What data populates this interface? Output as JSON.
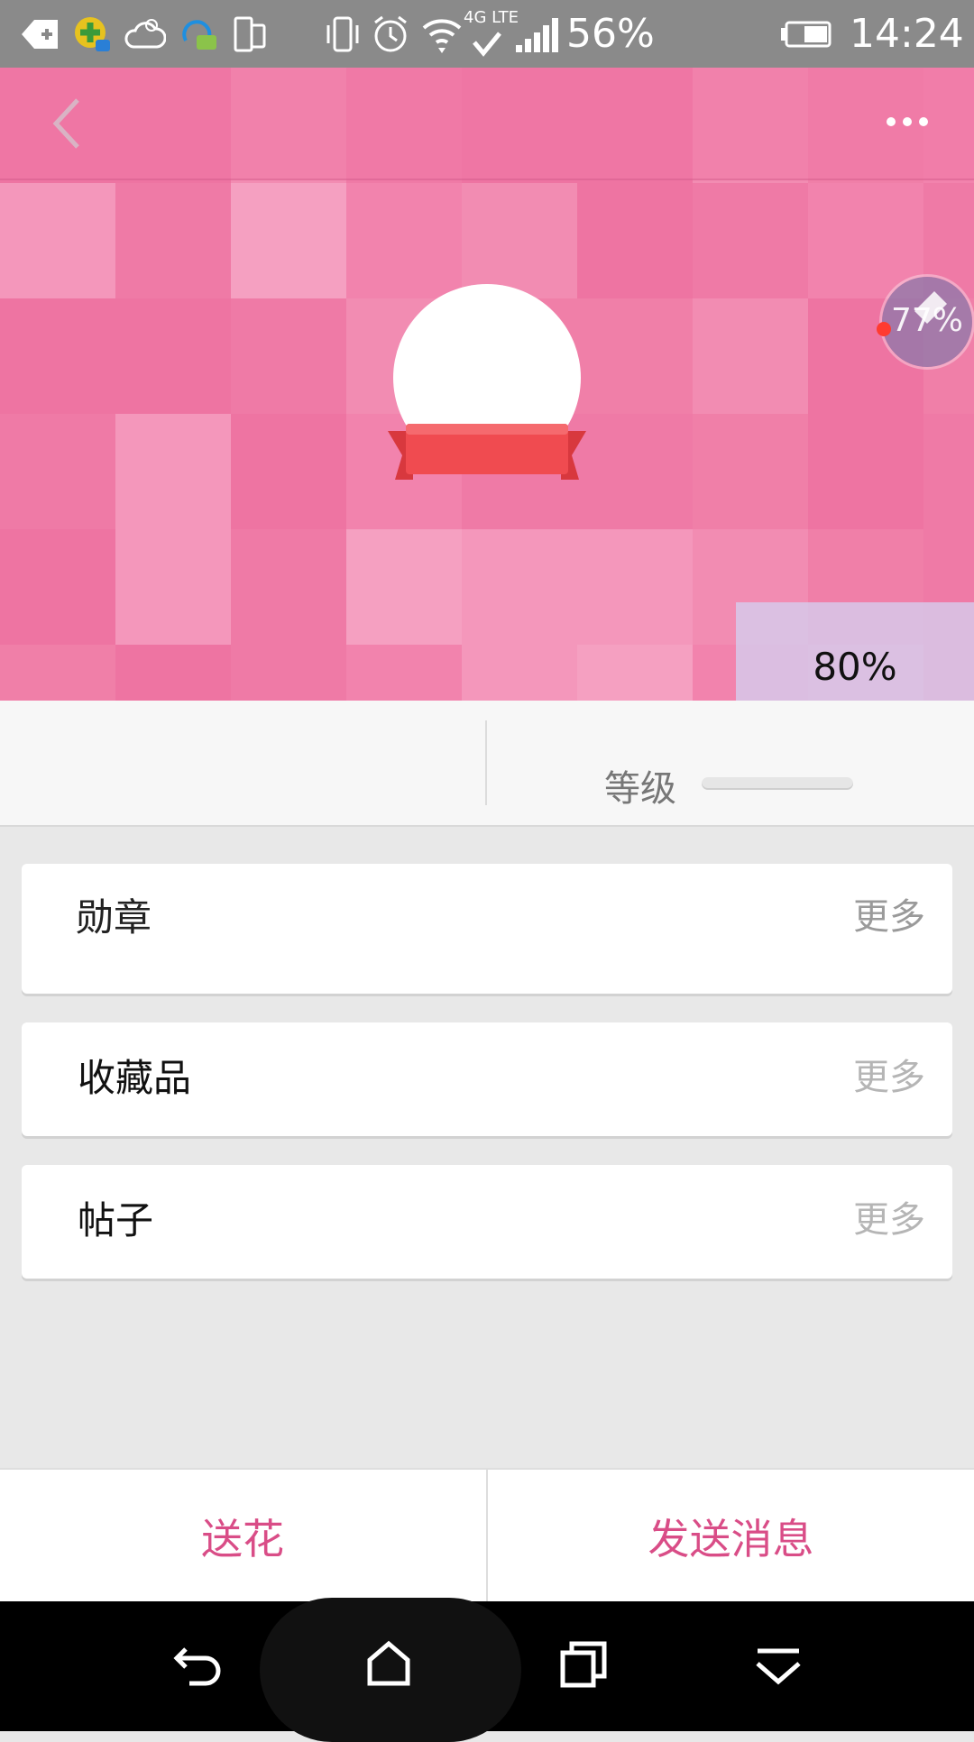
{
  "status_bar": {
    "battery_percent": "56%",
    "time": "14:24",
    "network": "4G LTE",
    "icons": [
      "back-arrow-notification-icon",
      "plus-app-icon",
      "weather-cloud-icon",
      "chat-app-icon",
      "phone-tablet-icon",
      "vibrate-icon",
      "alarm-icon",
      "wifi-icon",
      "signal-icon",
      "battery-icon"
    ]
  },
  "header": {
    "back_icon": "chevron-left-icon",
    "more_icon": "more-dots-icon",
    "accent_color": "#f07fa8"
  },
  "floating_ball": {
    "text": "77%"
  },
  "overlay": {
    "percent_text": "80%"
  },
  "stats": {
    "level_label": "等级"
  },
  "sections": [
    {
      "title": "勋章",
      "more": "更多"
    },
    {
      "title": "收藏品",
      "more": "更多"
    },
    {
      "title": "帖子",
      "more": "更多"
    }
  ],
  "actions": {
    "send_flower": "送花",
    "send_message": "发送消息",
    "color": "#d94d87"
  },
  "nav": {
    "icons": [
      "back-icon",
      "home-icon",
      "recents-icon",
      "dropdown-icon"
    ]
  }
}
